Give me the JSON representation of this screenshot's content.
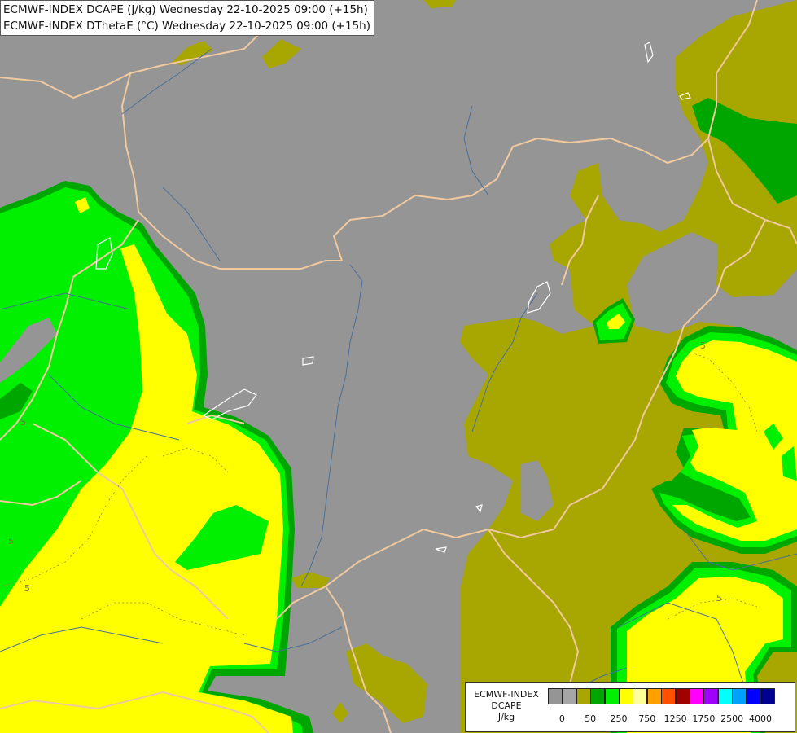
{
  "title": {
    "line1": "ECMWF-INDEX DCAPE (J/kg) Wednesday 22-10-2025 09:00 (+15h)",
    "line2": "ECMWF-INDEX DThetaE (°C) Wednesday 22-10-2025 09:00 (+15h)"
  },
  "legend": {
    "label_line1": "ECMWF-INDEX",
    "label_line2": "DCAPE",
    "label_line3": "J/kg",
    "colors": [
      "#959595",
      "#a6a6a6",
      "#a8a600",
      "#00a600",
      "#00f000",
      "#ffff00",
      "#ffff99",
      "#ffa000",
      "#ff5000",
      "#a00000",
      "#ff00ff",
      "#a000ff",
      "#00ffff",
      "#00a0ff",
      "#0000ff",
      "#000090"
    ],
    "ticks": [
      "0",
      "50",
      "250",
      "750",
      "1250",
      "1750",
      "2500",
      "4000"
    ]
  },
  "contour_labels": [
    "5",
    "5",
    "5",
    "5",
    "5"
  ],
  "colors": {
    "background_gray": "#959595",
    "olive": "#a8a600",
    "dark_green": "#00a600",
    "green": "#00f000",
    "yellow": "#ffff00",
    "border_line": "#f0c9a0",
    "river_line": "#4a6f9a",
    "contour_line": "#8a8a50"
  }
}
